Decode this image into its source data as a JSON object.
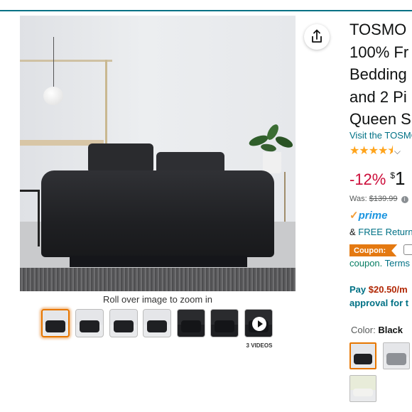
{
  "product": {
    "title_lines": [
      "TOSMO",
      "100% Fr",
      "Bedding",
      "and 2 Pi",
      "Queen S"
    ],
    "store_link": "Visit the TOSMO",
    "rating_stars": "★★★★⯨",
    "rating_chevron": "⌵",
    "discount": "-12%",
    "currency": "$",
    "price": "1",
    "was_label": "Was:",
    "was_price": "$139.99",
    "prime_check": "✓",
    "prime_label": "prime",
    "returns_prefix": "&",
    "returns_link": "FREE Return",
    "coupon_badge": "Coupon:",
    "coupon_text": "coupon.",
    "coupon_terms": "Terms",
    "pay_line1_prefix": "Pay",
    "pay_amount": "$20.50/m",
    "pay_line2": "approval for t",
    "color_label": "Color:",
    "color_value": "Black"
  },
  "gallery": {
    "zoom_hint": "Roll over image to zoom in",
    "videos_label": "3 VIDEOS",
    "thumb_count": 7,
    "active_thumb": 0
  },
  "icons": {
    "share": "share-icon",
    "play": "play-icon",
    "info": "info-icon"
  },
  "colors": {
    "link": "#007185",
    "discount": "#cc0c39",
    "star": "#ffa41c",
    "coupon": "#e47911",
    "coupon_text": "#067d62",
    "prime_blue": "#1b95e0",
    "active_border": "#e77600"
  }
}
